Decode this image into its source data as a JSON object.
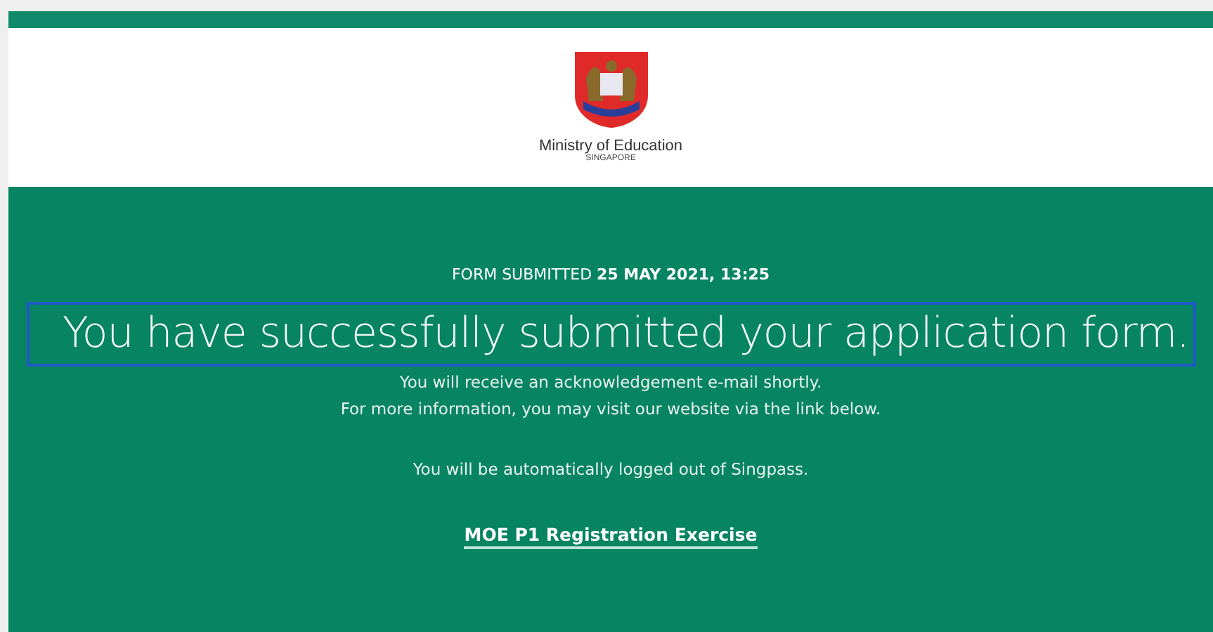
{
  "header": {
    "org_name": "Ministry of Education",
    "org_country": "SINGAPORE"
  },
  "confirmation": {
    "timestamp": "FORM SUBMITTED **25 MAY 2021, 13:25**",
    "headline": "You have successfully submitted your application form.",
    "headline_selected": true,
    "messages": [
      "You will receive an acknowledgement e-mail shortly.",
      "For more information, you may visit our website via the link below."
    ],
    "logout_note": "You will be automatically logged out of Singpass.",
    "link": "MOE P1 Registration Exercise"
  }
}
